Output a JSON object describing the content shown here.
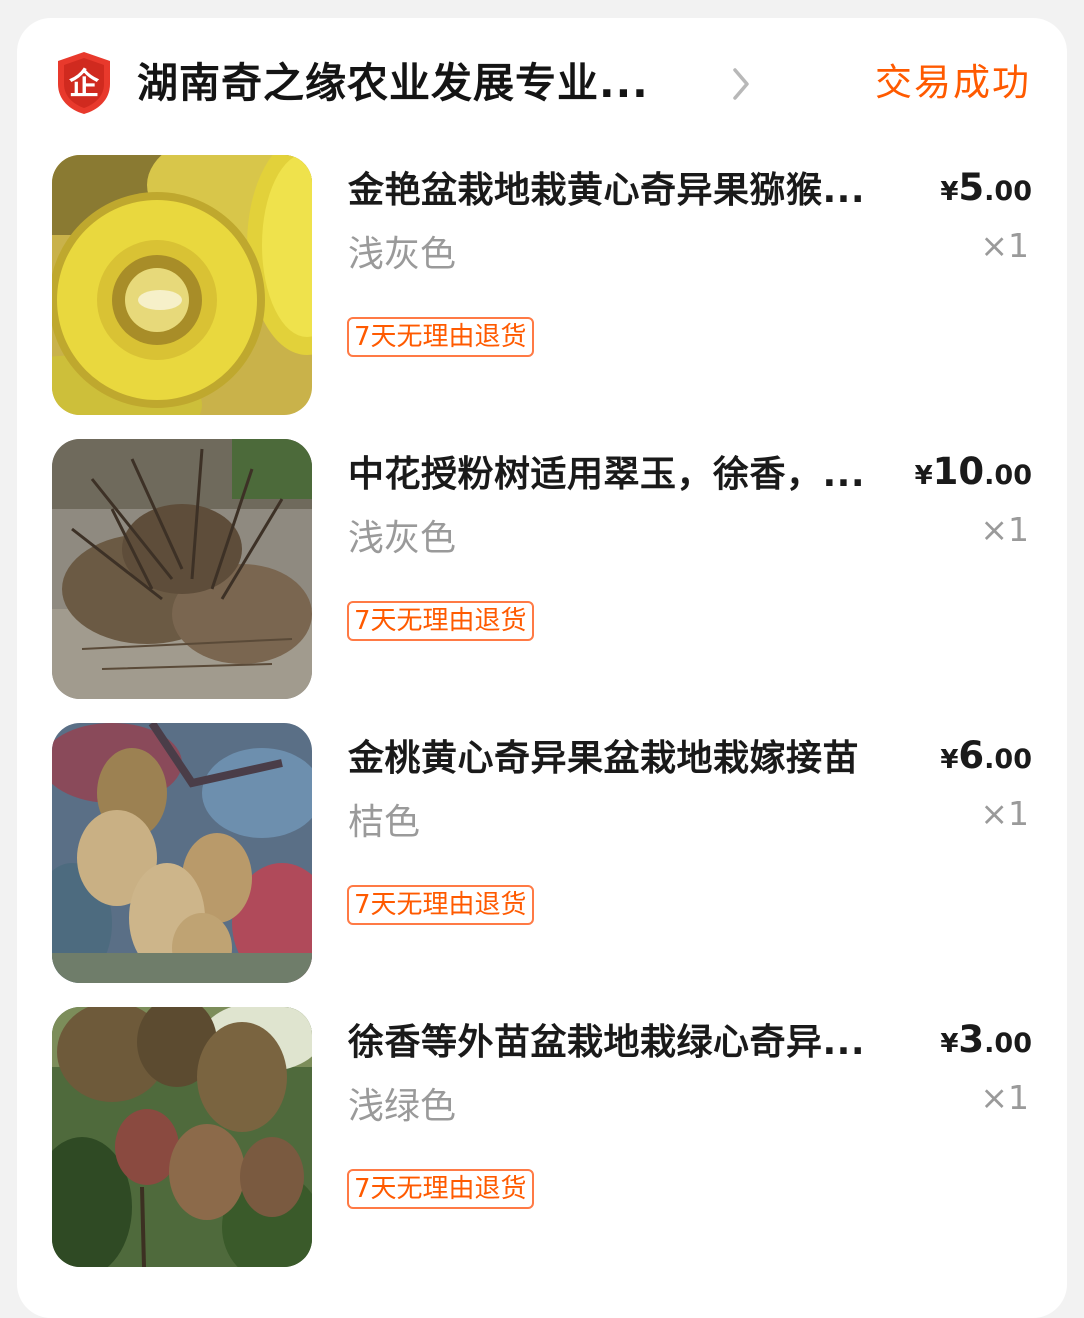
{
  "shop": {
    "badge_text": "企",
    "badge_icon": "enterprise-shield-icon",
    "name": "湖南奇之缘农业发展专业...",
    "chevron_icon": "chevron-right-icon",
    "status": "交易成功",
    "status_color": "#ff5a00"
  },
  "items": [
    {
      "title": "金艳盆栽地栽黄心奇异果猕猴...",
      "sku": "浅灰色",
      "tag": "7天无理由退货",
      "currency": "¥",
      "price_int": "5",
      "price_dec": ".00",
      "qty": "×1",
      "image": "golden-kiwi-cut-image"
    },
    {
      "title": "中花授粉树适用翠玉，徐香，...",
      "sku": "浅灰色",
      "tag": "7天无理由退货",
      "currency": "¥",
      "price_int": "10",
      "price_dec": ".00",
      "qty": "×1",
      "image": "bare-root-saplings-image"
    },
    {
      "title": "金桃黄心奇异果盆栽地栽嫁接苗",
      "sku": "桔色",
      "tag": "7天无理由退货",
      "currency": "¥",
      "price_int": "6",
      "price_dec": ".00",
      "qty": "×1",
      "image": "kiwi-cluster-on-vine-image"
    },
    {
      "title": "徐香等外苗盆栽地栽绿心奇异...",
      "sku": "浅绿色",
      "tag": "7天无理由退货",
      "currency": "¥",
      "price_int": "3",
      "price_dec": ".00",
      "qty": "×1",
      "image": "kiwi-fruits-hanging-image"
    }
  ]
}
